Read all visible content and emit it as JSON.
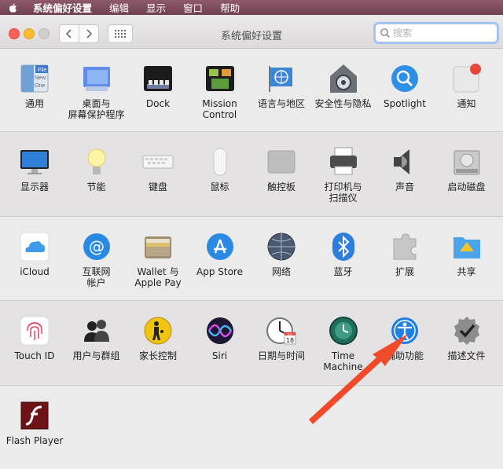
{
  "menubar": {
    "items": [
      "系统偏好设置",
      "编辑",
      "显示",
      "窗口",
      "帮助"
    ]
  },
  "window": {
    "title": "系统偏好设置"
  },
  "search": {
    "placeholder": "搜索"
  },
  "sections": [
    [
      {
        "label": "通用",
        "icon": "general-icon"
      },
      {
        "label": "桌面与\n屏幕保护程序",
        "icon": "desktop-screensaver-icon"
      },
      {
        "label": "Dock",
        "icon": "dock-icon"
      },
      {
        "label": "Mission\nControl",
        "icon": "mission-control-icon"
      },
      {
        "label": "语言与地区",
        "icon": "language-region-icon"
      },
      {
        "label": "安全性与隐私",
        "icon": "security-privacy-icon"
      },
      {
        "label": "Spotlight",
        "icon": "spotlight-icon"
      },
      {
        "label": "通知",
        "icon": "notifications-icon"
      }
    ],
    [
      {
        "label": "显示器",
        "icon": "displays-icon"
      },
      {
        "label": "节能",
        "icon": "energy-saver-icon"
      },
      {
        "label": "键盘",
        "icon": "keyboard-icon"
      },
      {
        "label": "鼠标",
        "icon": "mouse-icon"
      },
      {
        "label": "触控板",
        "icon": "trackpad-icon"
      },
      {
        "label": "打印机与\n扫描仪",
        "icon": "printers-scanners-icon"
      },
      {
        "label": "声音",
        "icon": "sound-icon"
      },
      {
        "label": "启动磁盘",
        "icon": "startup-disk-icon"
      }
    ],
    [
      {
        "label": "iCloud",
        "icon": "icloud-icon"
      },
      {
        "label": "互联网\n帐户",
        "icon": "internet-accounts-icon"
      },
      {
        "label": "Wallet 与\nApple Pay",
        "icon": "wallet-applepay-icon"
      },
      {
        "label": "App Store",
        "icon": "app-store-icon"
      },
      {
        "label": "网络",
        "icon": "network-icon"
      },
      {
        "label": "蓝牙",
        "icon": "bluetooth-icon"
      },
      {
        "label": "扩展",
        "icon": "extensions-icon"
      },
      {
        "label": "共享",
        "icon": "sharing-icon"
      }
    ],
    [
      {
        "label": "Touch ID",
        "icon": "touch-id-icon"
      },
      {
        "label": "用户与群组",
        "icon": "users-groups-icon"
      },
      {
        "label": "家长控制",
        "icon": "parental-controls-icon"
      },
      {
        "label": "Siri",
        "icon": "siri-icon"
      },
      {
        "label": "日期与时间",
        "icon": "date-time-icon"
      },
      {
        "label": "Time Machine",
        "icon": "time-machine-icon"
      },
      {
        "label": "辅助功能",
        "icon": "accessibility-icon"
      },
      {
        "label": "描述文件",
        "icon": "profiles-icon"
      }
    ],
    [
      {
        "label": "Flash Player",
        "icon": "flash-player-icon"
      }
    ]
  ],
  "date_icon": {
    "month": "JUL",
    "day": "18"
  },
  "general_icon": {
    "lines": [
      "File",
      "New",
      "One"
    ]
  },
  "colors": {
    "menubar": "#7d4d5e",
    "arrow": "#f04a2a",
    "close": "#fd5f57",
    "minimize": "#fdbc2e"
  }
}
